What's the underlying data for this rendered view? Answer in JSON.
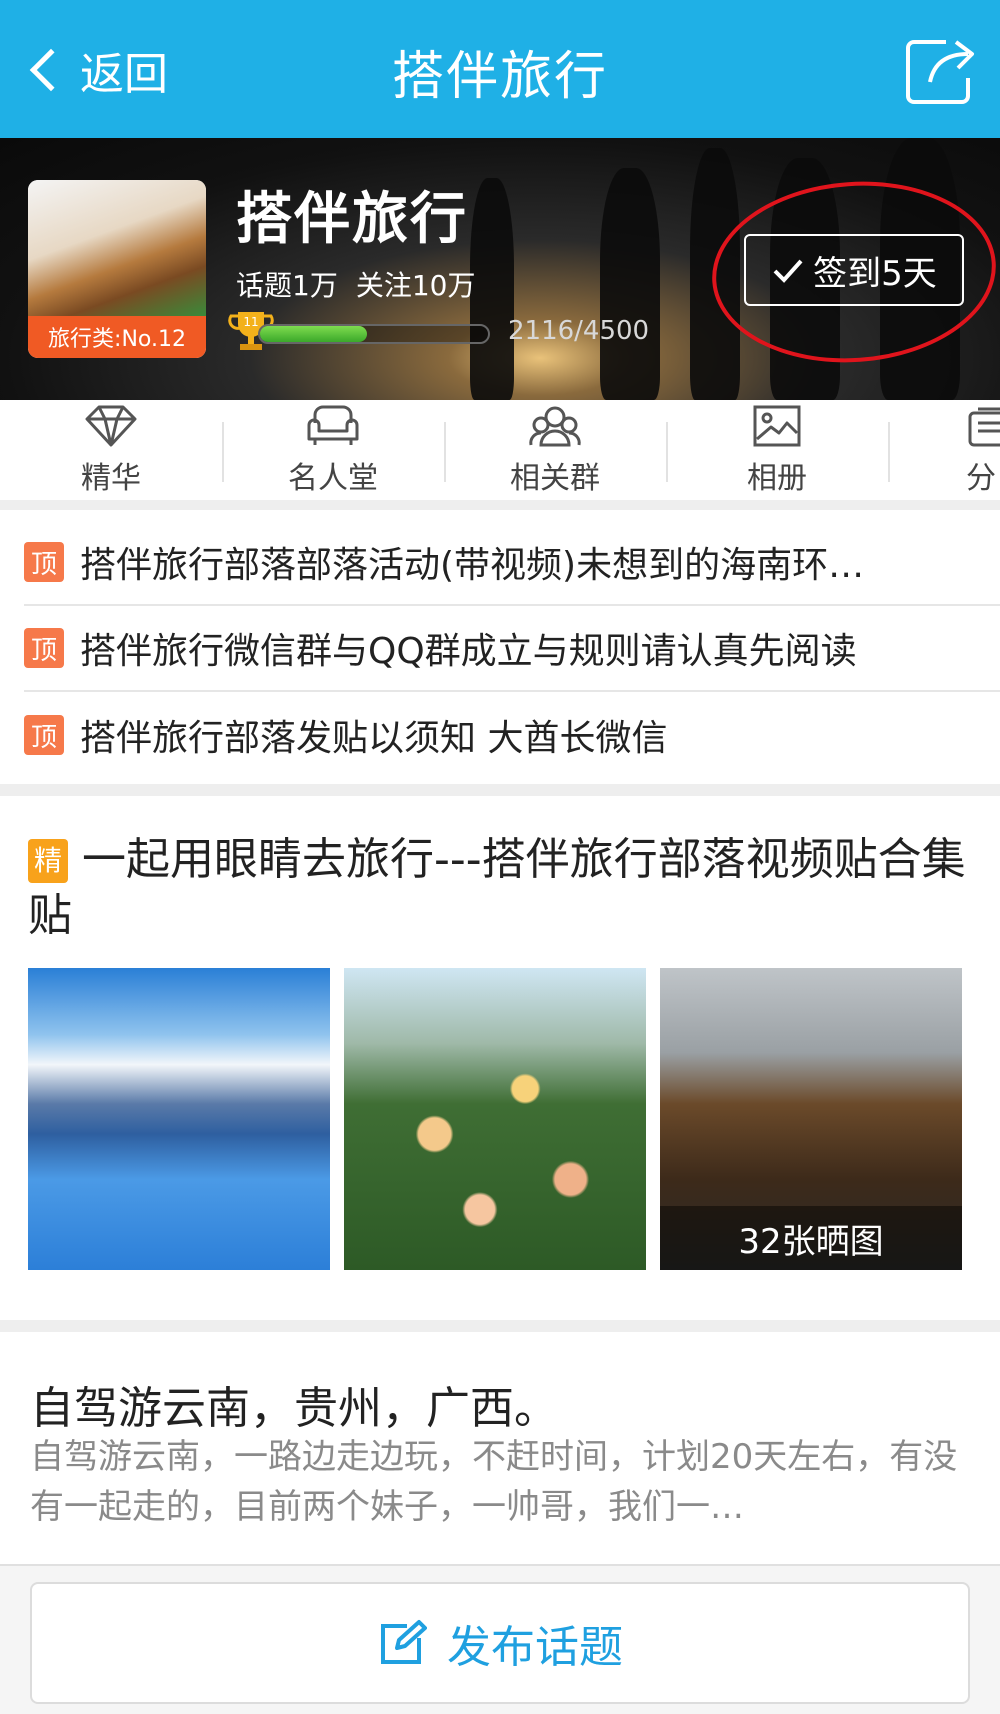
{
  "nav": {
    "back_label": "返回",
    "title": "搭伴旅行"
  },
  "group": {
    "name": "搭伴旅行",
    "rank_tag": "旅行类:No.12",
    "stats": [
      "话题1万",
      "关注10万"
    ],
    "level": "11",
    "progress_text": "2116/4500",
    "progress_fraction": 0.47,
    "checkin_label": "签到5天"
  },
  "tabs": [
    {
      "label": "精华",
      "icon": "diamond-icon"
    },
    {
      "label": "名人堂",
      "icon": "sofa-icon"
    },
    {
      "label": "相关群",
      "icon": "group-icon"
    },
    {
      "label": "相册",
      "icon": "photo-icon"
    },
    {
      "label": "分",
      "icon": "share-list-icon"
    }
  ],
  "pinned": {
    "badge": "顶",
    "items": [
      "搭伴旅行部落部落活动(带视频)未想到的海南环…",
      "搭伴旅行微信群与QQ群成立与规则请认真先阅读",
      "搭伴旅行部落发贴以须知 大酋长微信"
    ]
  },
  "featured": {
    "badge": "精",
    "title": "一起用眼睛去旅行---搭伴旅行部落视频贴合集贴",
    "photo_caption": "32张晒图"
  },
  "post": {
    "title": "自驾游云南，贵州，广西。",
    "body": "自驾游云南，一路边走边玩，不赶时间，计划20天左右，有没有一起走的，目前两个妹子，一帅哥，我们一…"
  },
  "compose": {
    "label": "发布话题"
  },
  "colors": {
    "nav_bg": "#1fb0e6",
    "pin_badge": "#f6794a",
    "jing_badge": "#f8a21b",
    "rank_tag": "#f05a24",
    "compose_text": "#1fa0e0",
    "annotation_ring": "#e0141c"
  }
}
